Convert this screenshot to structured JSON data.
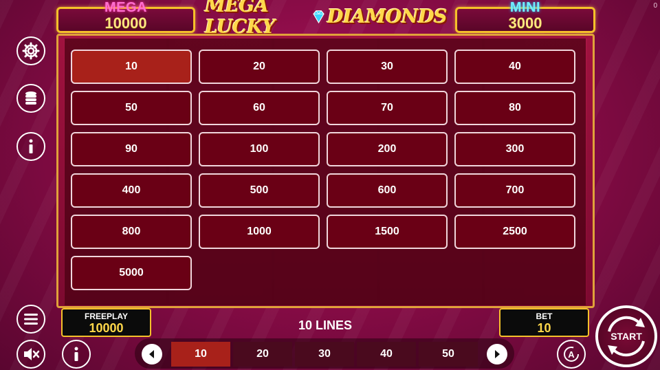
{
  "corner_counter": "0",
  "jackpots": {
    "mega": {
      "title": "MEGA",
      "value": "10000"
    },
    "mini": {
      "title": "MINI",
      "value": "3000"
    }
  },
  "logo": {
    "part1": "MEGA LUCKY",
    "part2": "DIAMONDS"
  },
  "bet_options": [
    "10",
    "20",
    "30",
    "40",
    "50",
    "60",
    "70",
    "80",
    "90",
    "100",
    "200",
    "300",
    "400",
    "500",
    "600",
    "700",
    "800",
    "1000",
    "1500",
    "2500",
    "5000"
  ],
  "selected_bet": "10",
  "side_icons": {
    "settings": "gear-icon",
    "coins": "coins-icon",
    "info": "info-icon",
    "menu": "menu-icon",
    "sound": "sound-muted-icon",
    "paytable": "info-icon"
  },
  "freeplay": {
    "label": "FREEPLAY",
    "value": "10000"
  },
  "bet": {
    "label": "BET",
    "value": "10"
  },
  "lines_label": "10 LINES",
  "line_options": [
    "10",
    "20",
    "30",
    "40",
    "50"
  ],
  "selected_line": "10",
  "start_label": "START",
  "colors": {
    "gold": "#f5c12a",
    "selected": "#a8211a",
    "mega": "#ff6fd0",
    "mini": "#6ff0ff"
  }
}
